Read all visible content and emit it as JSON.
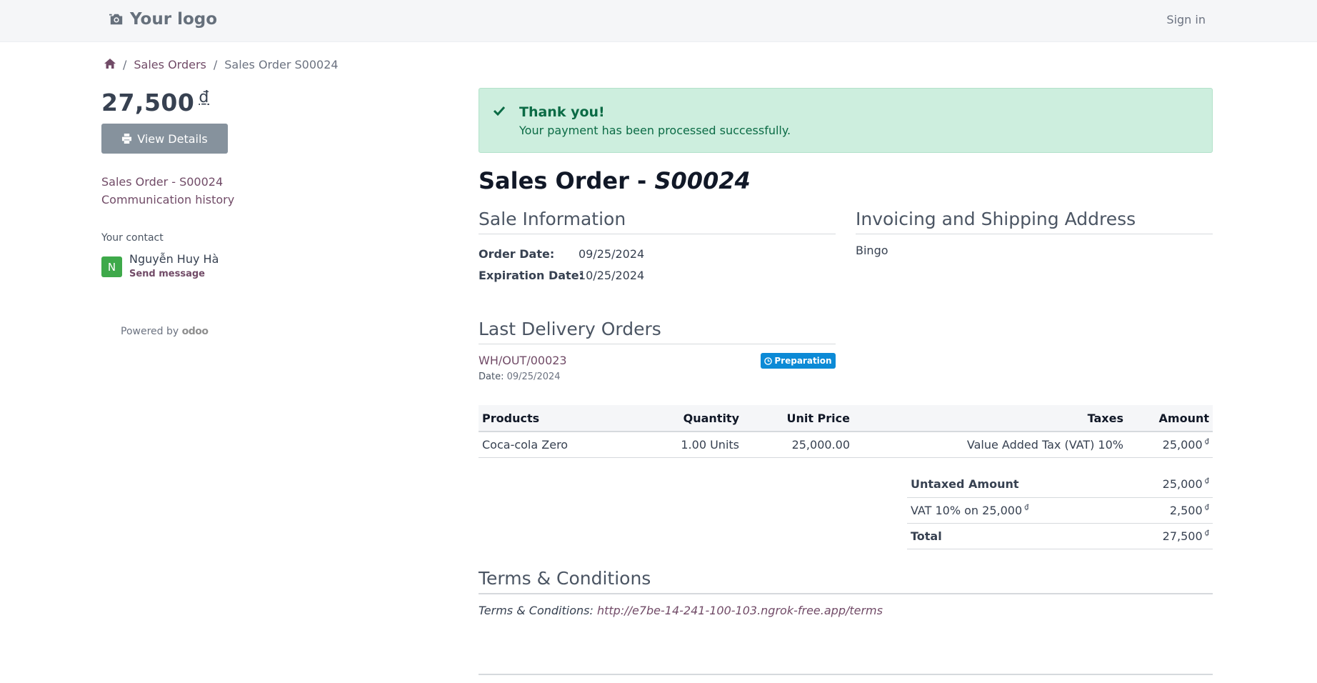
{
  "header": {
    "logo_text": "Your logo",
    "signin_label": "Sign in"
  },
  "breadcrumb": {
    "home_icon": "home-icon",
    "items": [
      {
        "label": "Sales Orders"
      },
      {
        "label": "Sales Order S00024"
      }
    ],
    "separator": "/"
  },
  "sidebar": {
    "amount": "27,500",
    "currency": "₫",
    "view_details_label": "View Details",
    "links": [
      {
        "label": "Sales Order - S00024"
      },
      {
        "label": "Communication history"
      }
    ],
    "contact_title": "Your contact",
    "contact_initial": "N",
    "contact_name": "Nguyễn Huy Hà",
    "send_message_label": "Send message",
    "powered_by_label": "Powered by",
    "powered_by_brand": "odoo"
  },
  "alert": {
    "title": "Thank you!",
    "message": "Your payment has been processed successfully."
  },
  "order": {
    "title_prefix": "Sales Order - ",
    "number": "S00024"
  },
  "sale_info": {
    "heading": "Sale Information",
    "order_date_label": "Order Date:",
    "order_date": "09/25/2024",
    "expiration_date_label": "Expiration Date:",
    "expiration_date": "10/25/2024"
  },
  "address": {
    "heading": "Invoicing and Shipping Address",
    "name": "Bingo"
  },
  "delivery": {
    "heading": "Last Delivery Orders",
    "ref": "WH/OUT/00023",
    "status": "Preparation",
    "date_label": "Date:",
    "date": "09/25/2024"
  },
  "products": {
    "headers": [
      "Products",
      "Quantity",
      "Unit Price",
      "Taxes",
      "Amount"
    ],
    "rows": [
      {
        "product": "Coca-cola Zero",
        "quantity": "1.00 Units",
        "unit_price": "25,000.00",
        "taxes": "Value Added Tax (VAT) 10%",
        "amount": "25,000",
        "currency": "₫"
      }
    ]
  },
  "totals": {
    "untaxed_label": "Untaxed Amount",
    "untaxed_value": "25,000",
    "vat_label": "VAT 10% on 25,000",
    "vat_value": "2,500",
    "total_label": "Total",
    "total_value": "27,500",
    "currency": "₫"
  },
  "terms": {
    "heading": "Terms & Conditions",
    "label": "Terms & Conditions:",
    "url": "http://e7be-14-241-100-103.ngrok-free.app/terms"
  },
  "colors": {
    "accent": "#714b67",
    "success_bg": "#cdeede",
    "success_text": "#0b6b45",
    "badge": "#0c8ad6",
    "button": "#86929d",
    "avatar": "#3ea94a"
  }
}
